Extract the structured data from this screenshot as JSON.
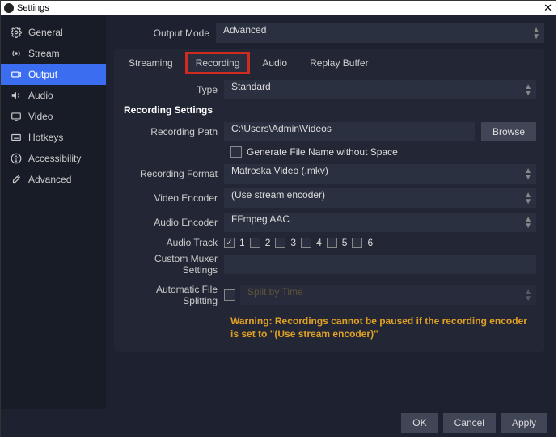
{
  "window": {
    "title": "Settings"
  },
  "sidebar": {
    "items": [
      {
        "label": "General"
      },
      {
        "label": "Stream"
      },
      {
        "label": "Output"
      },
      {
        "label": "Audio"
      },
      {
        "label": "Video"
      },
      {
        "label": "Hotkeys"
      },
      {
        "label": "Accessibility"
      },
      {
        "label": "Advanced"
      }
    ]
  },
  "output_mode": {
    "label": "Output Mode",
    "value": "Advanced"
  },
  "tabs": {
    "items": [
      {
        "label": "Streaming"
      },
      {
        "label": "Recording"
      },
      {
        "label": "Audio"
      },
      {
        "label": "Replay Buffer"
      }
    ]
  },
  "type": {
    "label": "Type",
    "value": "Standard"
  },
  "section": {
    "title": "Recording Settings"
  },
  "path": {
    "label": "Recording Path",
    "value": "C:\\Users\\Admin\\Videos",
    "browse": "Browse"
  },
  "filename_nospace": {
    "label": "Generate File Name without Space"
  },
  "format": {
    "label": "Recording Format",
    "value": "Matroska Video (.mkv)"
  },
  "vencoder": {
    "label": "Video Encoder",
    "value": "(Use stream encoder)"
  },
  "aencoder": {
    "label": "Audio Encoder",
    "value": "FFmpeg AAC"
  },
  "tracks": {
    "label": "Audio Track",
    "t1": "1",
    "t2": "2",
    "t3": "3",
    "t4": "4",
    "t5": "5",
    "t6": "6"
  },
  "muxer": {
    "label": "Custom Muxer Settings",
    "value": ""
  },
  "split": {
    "label": "Automatic File Splitting",
    "value": "Split by Time"
  },
  "warning": "Warning: Recordings cannot be paused if the recording encoder is set to \"(Use stream encoder)\"",
  "footer": {
    "ok": "OK",
    "cancel": "Cancel",
    "apply": "Apply"
  }
}
